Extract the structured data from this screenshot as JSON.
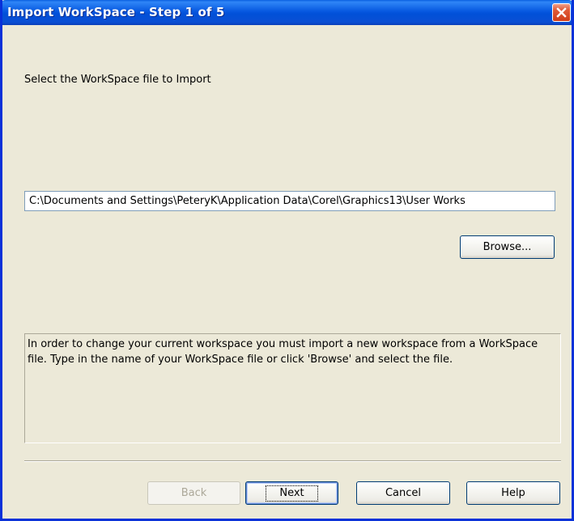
{
  "window": {
    "title": "Import WorkSpace - Step 1 of 5",
    "close_icon": "close-icon"
  },
  "step": {
    "prompt": "Select the WorkSpace file to Import",
    "file_path": "C:\\Documents and Settings\\PeteryK\\Application Data\\Corel\\Graphics13\\User Works",
    "browse_label": "Browse..."
  },
  "info": {
    "text": "In order to change your current workspace you must import a new workspace from a WorkSpace file. Type in the name of your WorkSpace file or click 'Browse' and select the file."
  },
  "buttons": {
    "back": "Back",
    "next": "Next",
    "cancel": "Cancel",
    "help": "Help"
  },
  "colors": {
    "titlebar": "#0150d8",
    "dialog_bg": "#ece9d8",
    "close_button": "#cf3d18",
    "button_border": "#003c74"
  }
}
